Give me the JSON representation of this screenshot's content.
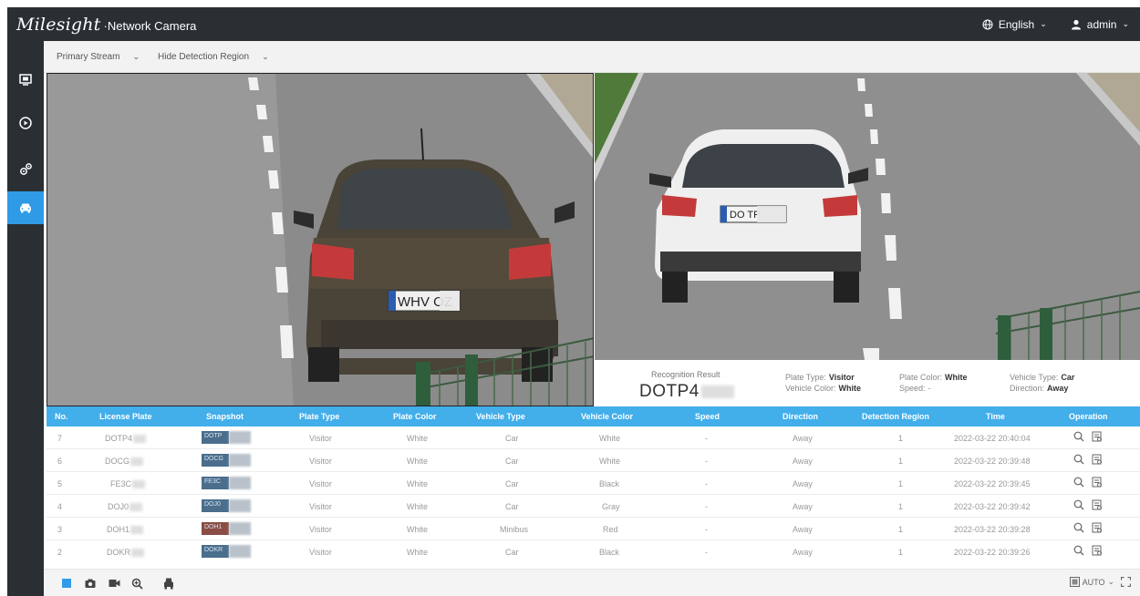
{
  "header": {
    "logo": "Milesight",
    "subtitle": "Network Camera",
    "language": "English",
    "user": "admin"
  },
  "toolbar": {
    "stream": "Primary Stream",
    "region": "Hide Detection Region"
  },
  "recognition": {
    "label": "Recognition Result",
    "plate": "DOTP4",
    "plate_type_label": "Plate Type:",
    "plate_type": "Visitor",
    "plate_color_label": "Plate Color:",
    "plate_color": "White",
    "vehicle_type_label": "Vehicle Type:",
    "vehicle_type": "Car",
    "vehicle_color_label": "Vehicle Color:",
    "vehicle_color": "White",
    "speed_label": "Speed:",
    "speed": "-",
    "direction_label": "Direction:",
    "direction": "Away"
  },
  "table": {
    "headers": [
      "No.",
      "License Plate",
      "Snapshot",
      "Plate Type",
      "Plate Color",
      "Vehicle Type",
      "Vehicle Color",
      "Speed",
      "Direction",
      "Detection Region",
      "Time",
      "Operation"
    ],
    "rows": [
      {
        "no": "7",
        "plate": "DOTP4",
        "snap": "DOTP",
        "plate_type": "Visitor",
        "plate_color": "White",
        "vehicle_type": "Car",
        "vehicle_color": "White",
        "speed": "-",
        "direction": "Away",
        "region": "1",
        "time": "2022-03-22 20:40:04"
      },
      {
        "no": "6",
        "plate": "DOCG",
        "snap": "DOCG",
        "plate_type": "Visitor",
        "plate_color": "White",
        "vehicle_type": "Car",
        "vehicle_color": "White",
        "speed": "-",
        "direction": "Away",
        "region": "1",
        "time": "2022-03-22 20:39:48"
      },
      {
        "no": "5",
        "plate": "FE3C",
        "snap": "FE3C",
        "plate_type": "Visitor",
        "plate_color": "White",
        "vehicle_type": "Car",
        "vehicle_color": "Black",
        "speed": "-",
        "direction": "Away",
        "region": "1",
        "time": "2022-03-22 20:39:45"
      },
      {
        "no": "4",
        "plate": "DOJ0",
        "snap": "DOJ0",
        "plate_type": "Visitor",
        "plate_color": "White",
        "vehicle_type": "Car",
        "vehicle_color": "Gray",
        "speed": "-",
        "direction": "Away",
        "region": "1",
        "time": "2022-03-22 20:39:42"
      },
      {
        "no": "3",
        "plate": "DOH1",
        "snap": "DOH1",
        "plate_type": "Visitor",
        "plate_color": "White",
        "vehicle_type": "Minibus",
        "vehicle_color": "Red",
        "speed": "-",
        "direction": "Away",
        "region": "1",
        "time": "2022-03-22 20:39:28"
      },
      {
        "no": "2",
        "plate": "DOKR",
        "snap": "DOKR",
        "plate_type": "Visitor",
        "plate_color": "White",
        "vehicle_type": "Car",
        "vehicle_color": "Black",
        "speed": "-",
        "direction": "Away",
        "region": "1",
        "time": "2022-03-22 20:39:26"
      }
    ]
  },
  "plates": {
    "left": "WHV OZ",
    "right": "DO TP"
  },
  "footer": {
    "zoom_mode": "AUTO"
  },
  "colors": {
    "topbar": "#2a2f34",
    "accent": "#2f9be6",
    "table_header": "#42aeea"
  },
  "icons": [
    "globe-icon",
    "user-icon",
    "live-view-icon",
    "playback-icon",
    "settings-icon",
    "vehicle-icon",
    "search-icon",
    "details-icon",
    "stop-icon",
    "snapshot-icon",
    "record-icon",
    "zoom-icon",
    "vehicle-capture-icon",
    "fit-window-icon",
    "fullscreen-icon"
  ]
}
